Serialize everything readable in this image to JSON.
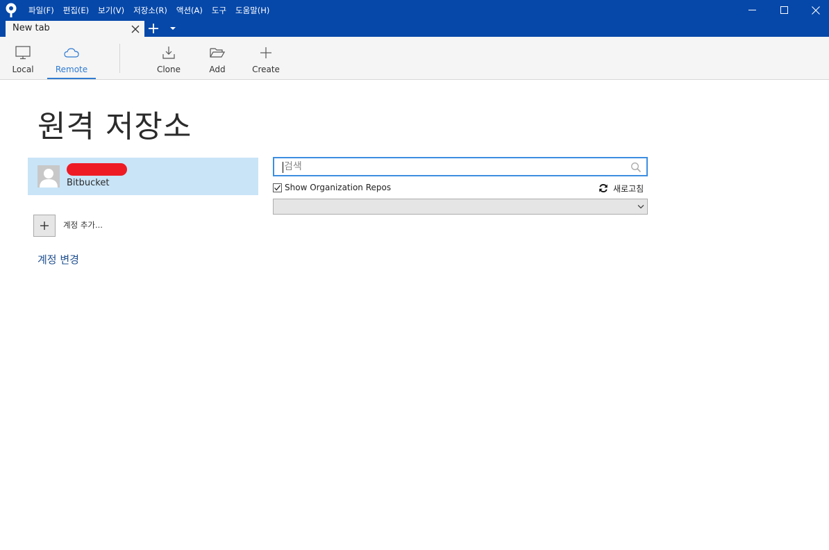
{
  "menu": {
    "items": [
      "파일(F)",
      "편집(E)",
      "보기(V)",
      "저장소(R)",
      "액션(A)",
      "도구",
      "도움말(H)"
    ]
  },
  "tabs": {
    "items": [
      {
        "label": "New tab",
        "active": true
      }
    ]
  },
  "toolbar": {
    "local_label": "Local",
    "remote_label": "Remote",
    "clone_label": "Clone",
    "add_label": "Add",
    "create_label": "Create",
    "active": "remote"
  },
  "content": {
    "title": "원격 저장소",
    "accounts": [
      {
        "name": "",
        "name_redacted": true,
        "service": "Bitbucket",
        "selected": true
      }
    ],
    "add_account_label": "계정 추가...",
    "change_account_label": "계정 변경"
  },
  "search": {
    "placeholder": "검색",
    "value": "",
    "show_org_repos_label": "Show Organization Repos",
    "show_org_repos_checked": true,
    "refresh_label": "새로고침",
    "select_value": ""
  },
  "colors": {
    "titlebar": "#0648a9",
    "accent": "#2f7bd1",
    "selected_item": "#c9e4f7",
    "redaction": "#ee1b24",
    "link": "#1f4f8f"
  },
  "icons": {
    "app": "sourcetree-logo-icon",
    "local": "monitor-icon",
    "remote": "cloud-icon",
    "clone": "download-icon",
    "add": "folder-open-icon",
    "create": "plus-icon",
    "search": "search-icon",
    "refresh": "refresh-icon"
  }
}
